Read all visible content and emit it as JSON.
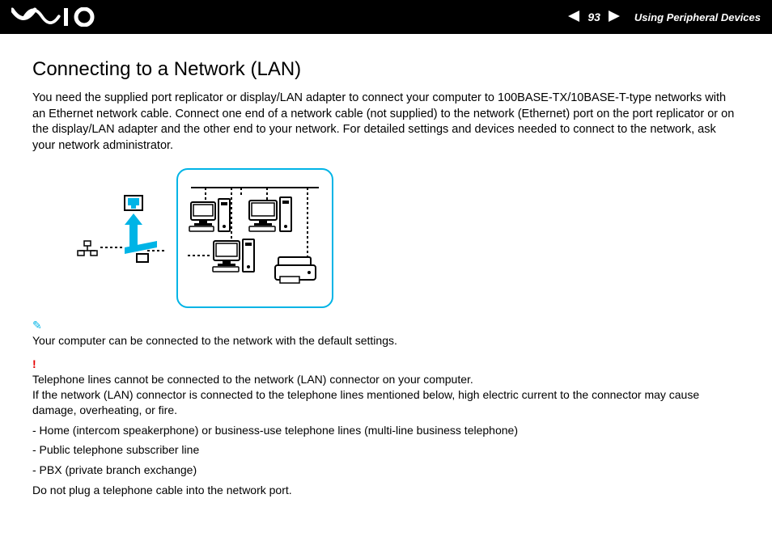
{
  "header": {
    "page_number": "93",
    "section": "Using Peripheral Devices"
  },
  "title": "Connecting to a Network (LAN)",
  "intro": "You need the supplied port replicator or display/LAN adapter to connect your computer to 100BASE-TX/10BASE-T-type networks with an Ethernet network cable. Connect one end of a network cable (not supplied) to the network (Ethernet) port on the port replicator or on the display/LAN adapter and the other end to your network. For detailed settings and devices needed to connect to the network, ask your network administrator.",
  "tip": "Your computer can be connected to the network with the default settings.",
  "warning1": "Telephone lines cannot be connected to the network (LAN) connector on your computer.",
  "warning2": "If the network (LAN) connector is connected to the telephone lines mentioned below, high electric current to the connector may cause damage, overheating, or fire.",
  "bullets": [
    "- Home (intercom speakerphone) or business-use telephone lines (multi-line business telephone)",
    "- Public telephone subscriber line",
    "- PBX (private branch exchange)"
  ],
  "final": "Do not plug a telephone cable into the network port."
}
